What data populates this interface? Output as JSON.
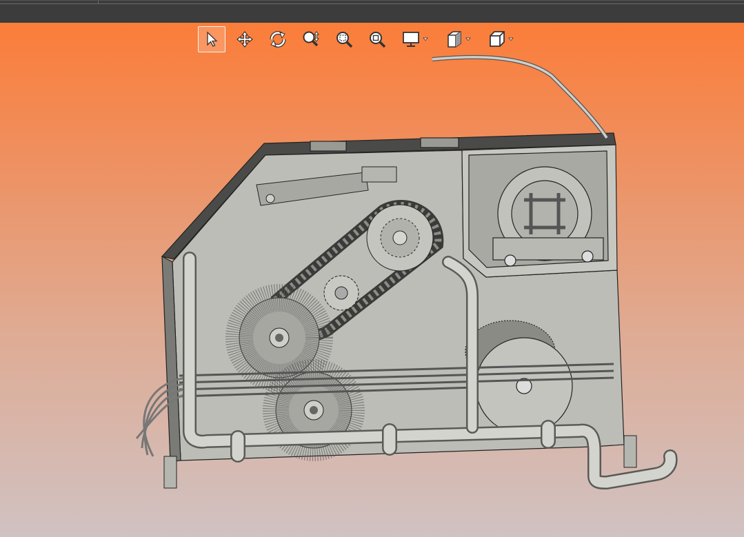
{
  "window": {
    "title": ""
  },
  "toolbar": {
    "buttons": [
      {
        "id": "select",
        "icon": "pointer-arrow-icon",
        "active": true
      },
      {
        "id": "pan",
        "icon": "move-arrows-icon",
        "active": false
      },
      {
        "id": "rotate",
        "icon": "rotate-icon",
        "active": false
      },
      {
        "id": "zoom-dynamic",
        "icon": "zoom-updown-icon",
        "active": false
      },
      {
        "id": "zoom-window",
        "icon": "zoom-window-icon",
        "active": false
      },
      {
        "id": "zoom-fit",
        "icon": "zoom-fit-icon",
        "active": false
      },
      {
        "id": "display-mode",
        "icon": "monitor-icon",
        "dropdown": true
      },
      {
        "id": "shading-mode",
        "icon": "shaded-cube-icon",
        "dropdown": true
      },
      {
        "id": "view-orientation",
        "icon": "wireframe-cube-icon",
        "dropdown": true
      }
    ]
  },
  "viewport": {
    "background_top": "#fb7d39",
    "background_bottom": "#d0c2c2",
    "model_color": "#bdbdb7",
    "model_dark": "#4a4a48",
    "model": "3D CAD assembly"
  }
}
